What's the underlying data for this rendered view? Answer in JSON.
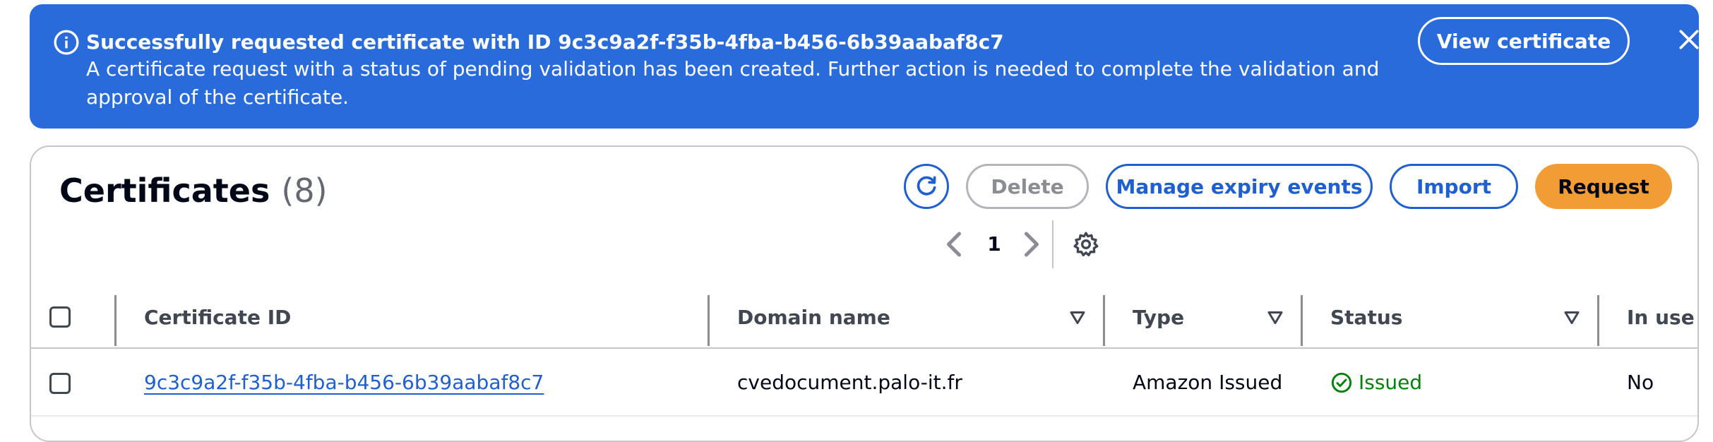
{
  "flash": {
    "title": "Successfully requested certificate with ID 9c3c9a2f-f35b-4fba-b456-6b39aabaf8c7",
    "message": "A certificate request with a status of pending validation has been created. Further action is needed to complete the validation and approval of the certificate.",
    "button_label": "View certificate",
    "icon": "info-icon",
    "close_icon": "close-icon",
    "color": "#2a6bdb"
  },
  "certificates": {
    "title": "Certificates",
    "count": "(8)",
    "actions": {
      "refresh_icon": "refresh-icon",
      "delete_label": "Delete",
      "manage_label": "Manage expiry events",
      "import_label": "Import",
      "request_label": "Request"
    },
    "pagination": {
      "current_page": "1"
    },
    "columns": [
      "Certificate ID",
      "Domain name",
      "Type",
      "Status",
      "In use"
    ],
    "rows": [
      {
        "id": "9c3c9a2f-f35b-4fba-b456-6b39aabaf8c7",
        "domain": "cvedocument.palo-it.fr",
        "type": "Amazon Issued",
        "status": "Issued",
        "in_use": "No"
      }
    ]
  },
  "colors": {
    "primary": "#f29c35",
    "link": "#1f5fcf",
    "success": "#037f0c"
  }
}
